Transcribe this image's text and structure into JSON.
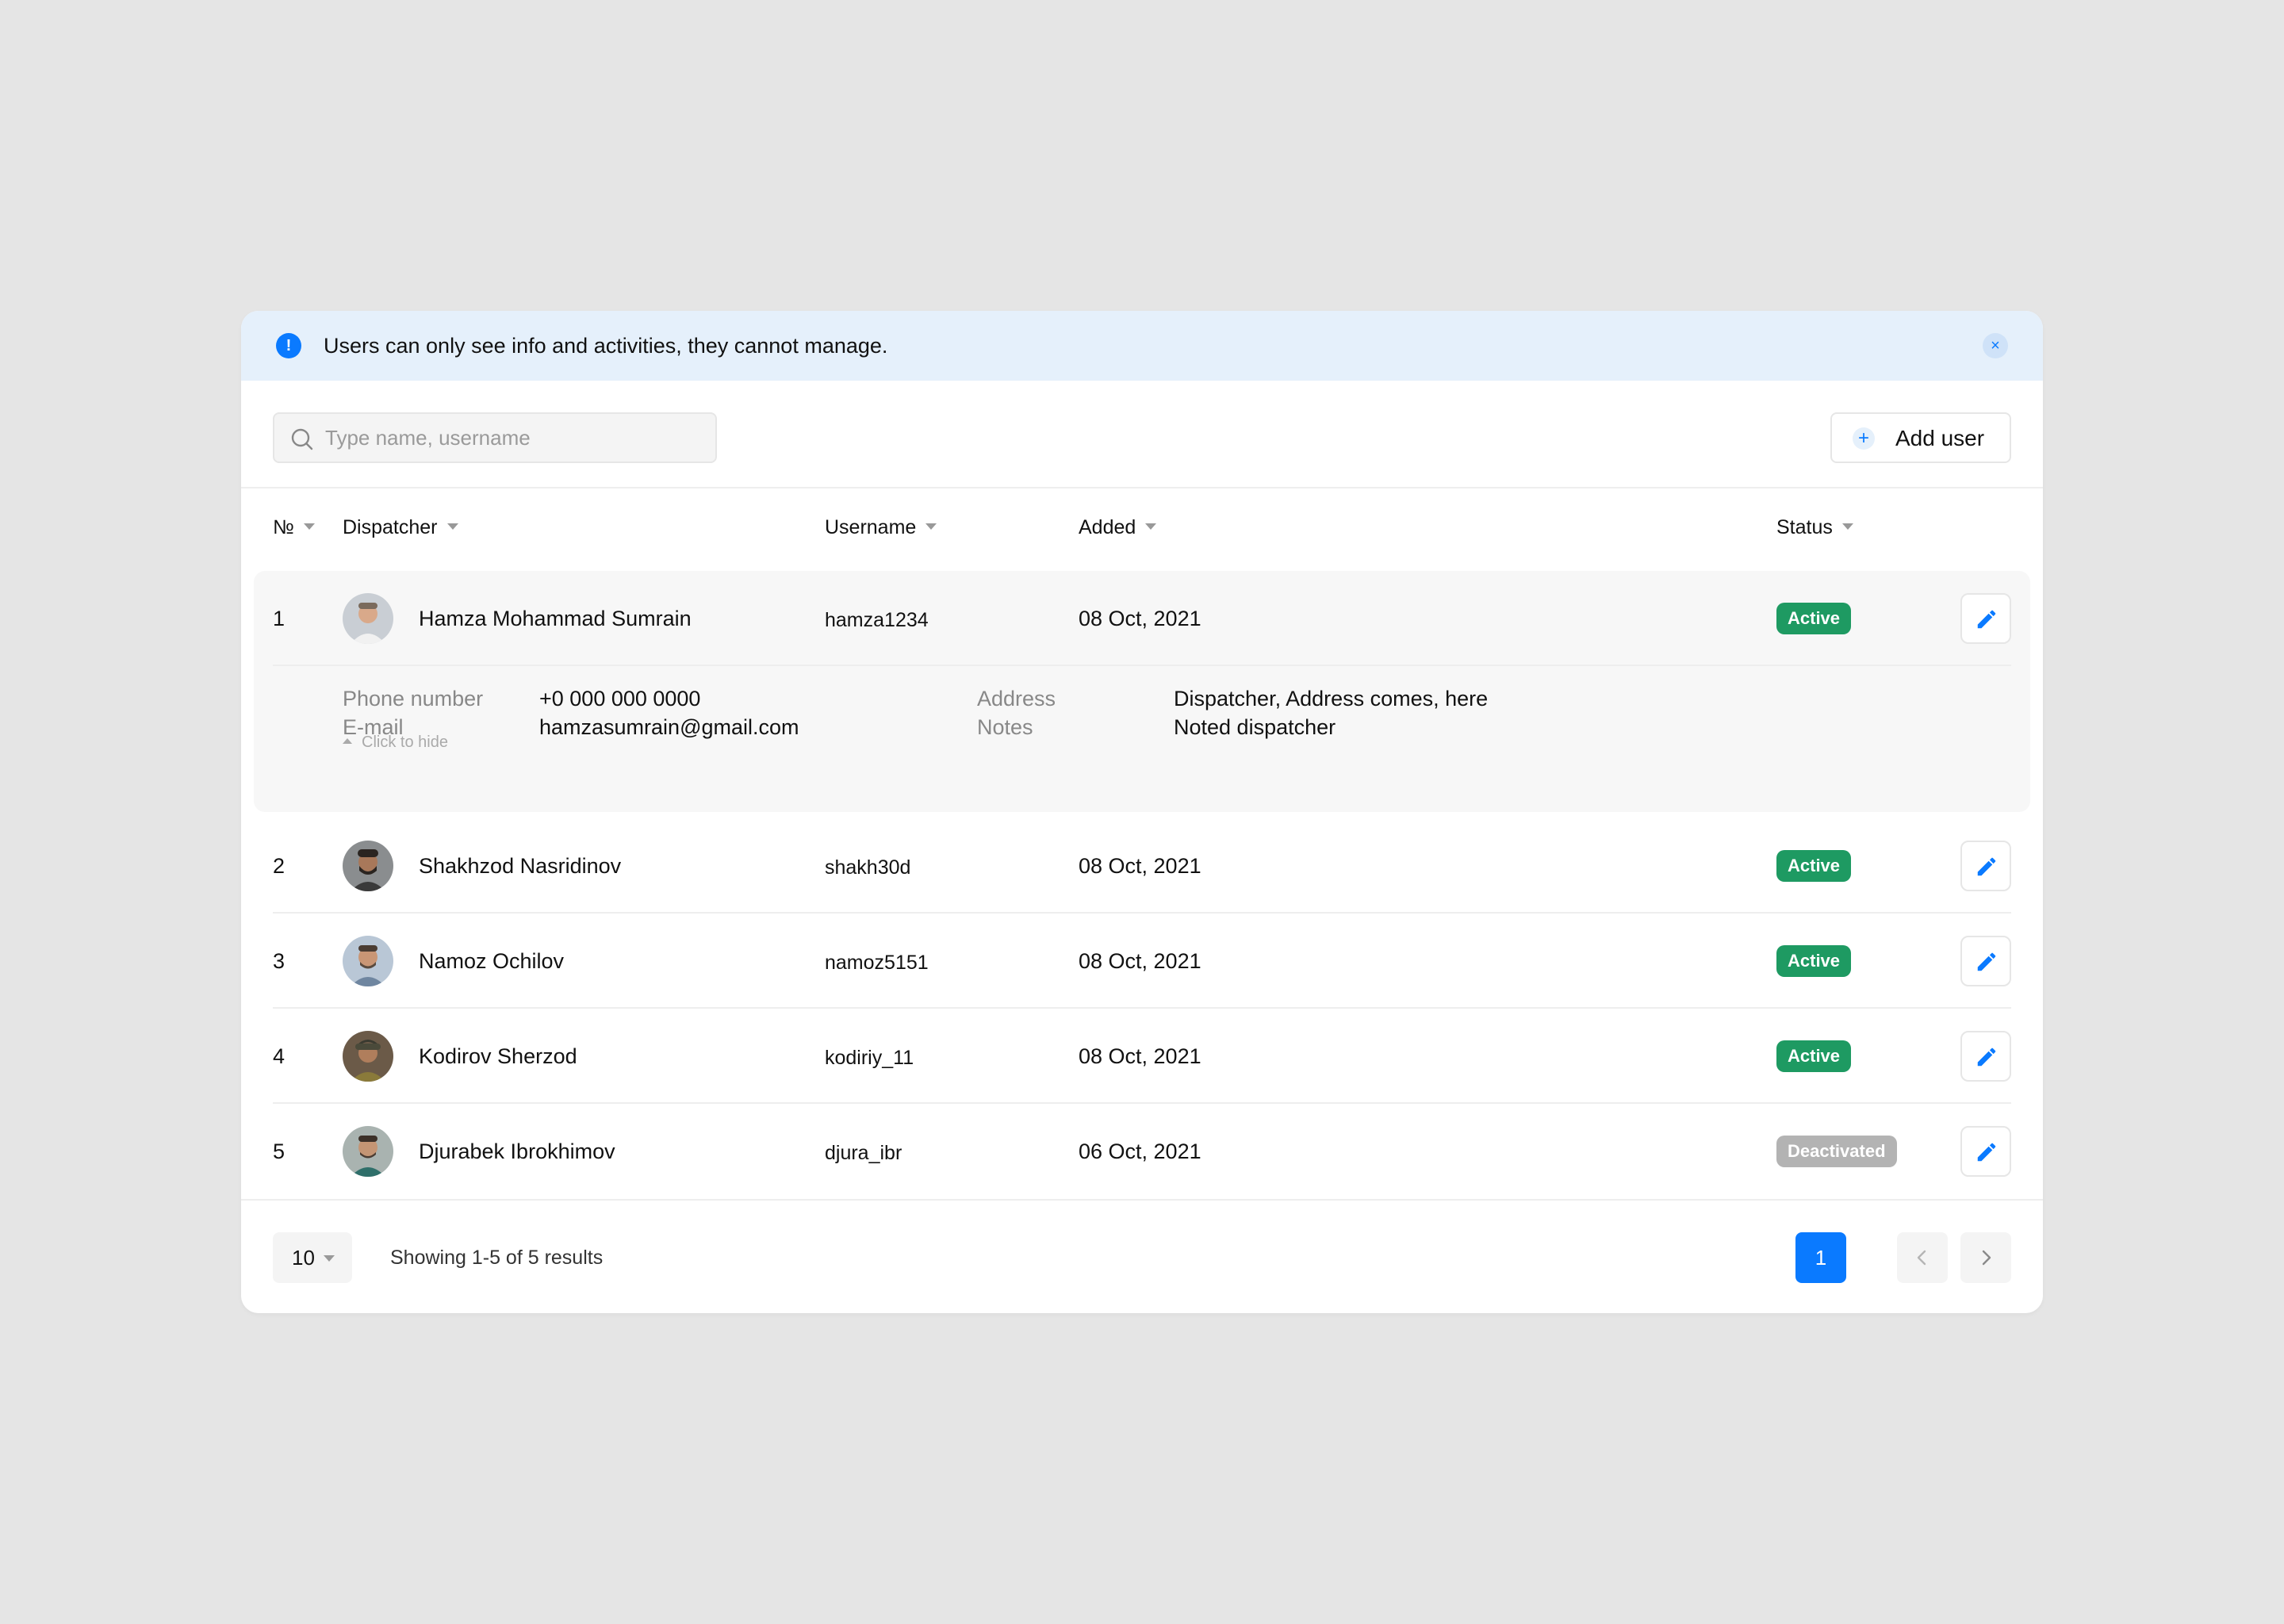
{
  "banner": {
    "message": "Users can only see info and activities, they cannot manage.",
    "info_icon": "!",
    "close_icon": "×"
  },
  "search": {
    "placeholder": "Type name, username",
    "value": ""
  },
  "add_user": {
    "label": "Add user",
    "icon": "+"
  },
  "table": {
    "headers": {
      "num": "№",
      "dispatcher": "Dispatcher",
      "username": "Username",
      "added": "Added",
      "status": "Status"
    },
    "rows": [
      {
        "num": "1",
        "name": "Hamza Mohammad Sumrain",
        "username": "hamza1234",
        "added": "08 Oct, 2021",
        "status": "Active"
      },
      {
        "num": "2",
        "name": "Shakhzod Nasridinov",
        "username": "shakh30d",
        "added": "08 Oct, 2021",
        "status": "Active"
      },
      {
        "num": "3",
        "name": "Namoz Ochilov",
        "username": "namoz5151",
        "added": "08 Oct, 2021",
        "status": "Active"
      },
      {
        "num": "4",
        "name": "Kodirov Sherzod",
        "username": "kodiriy_11",
        "added": "08 Oct, 2021",
        "status": "Active"
      },
      {
        "num": "5",
        "name": "Djurabek Ibrokhimov",
        "username": "djura_ibr",
        "added": "06 Oct, 2021",
        "status": "Deactivated"
      }
    ]
  },
  "details": {
    "phone_label": "Phone number",
    "phone_value": "+0 000 000 0000",
    "email_label": "E-mail",
    "email_value": "hamzasumrain@gmail.com",
    "address_label": "Address",
    "address_value": "Dispatcher, Address comes, here",
    "notes_label": "Notes",
    "notes_value": "Noted dispatcher",
    "hide_label": "Click to hide"
  },
  "footer": {
    "per_page": "10",
    "results_text": "Showing 1-5 of 5 results",
    "current_page": "1"
  },
  "colors": {
    "accent": "#0a7aff",
    "active": "#1e9a62",
    "deactivated": "#b3b3b3",
    "banner_bg": "#e5f0fb"
  }
}
